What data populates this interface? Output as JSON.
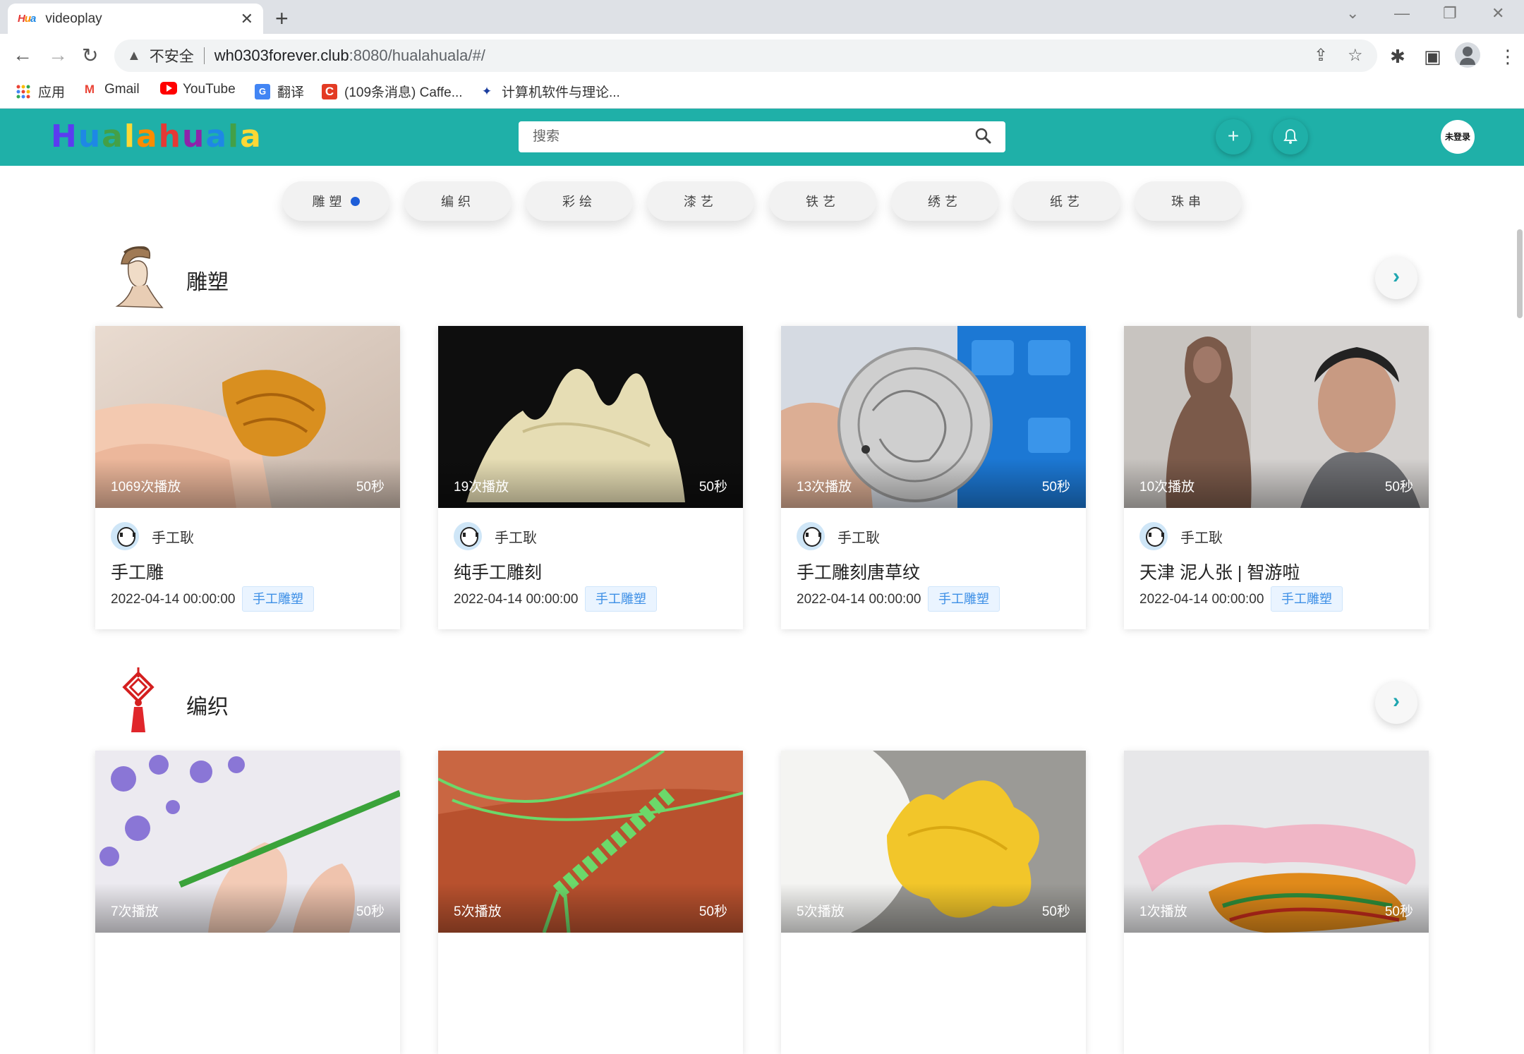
{
  "browser": {
    "tab_title": "videoplay",
    "favicon_text": "Hua",
    "insecure_label": "不安全",
    "url_host": "wh0303forever.club",
    "url_rest": ":8080/hualahuala/#/",
    "bookmarks": [
      {
        "label": "应用",
        "icon": "apps-grid-icon"
      },
      {
        "label": "Gmail",
        "icon": "gmail-icon"
      },
      {
        "label": "YouTube",
        "icon": "youtube-icon"
      },
      {
        "label": "翻译",
        "icon": "translate-icon"
      },
      {
        "label": "(109条消息) Caffe...",
        "icon": "csdn-icon"
      },
      {
        "label": "计算机软件与理论...",
        "icon": "site-icon"
      }
    ]
  },
  "header": {
    "logo_letters": [
      "H",
      "u",
      "a",
      "l",
      "a",
      "h",
      "u",
      "a",
      "l",
      "a"
    ],
    "search_placeholder": "搜索",
    "login_label": "未登录"
  },
  "categories": [
    {
      "label": "雕塑",
      "active": true
    },
    {
      "label": "编织",
      "active": false
    },
    {
      "label": "彩绘",
      "active": false
    },
    {
      "label": "漆艺",
      "active": false
    },
    {
      "label": "铁艺",
      "active": false
    },
    {
      "label": "绣艺",
      "active": false
    },
    {
      "label": "纸艺",
      "active": false
    },
    {
      "label": "珠串",
      "active": false
    }
  ],
  "sections": [
    {
      "title": "雕塑",
      "videos": [
        {
          "plays": "1069次播放",
          "duration": "50秒",
          "author": "手工耿",
          "title": "手工雕",
          "date": "2022-04-14 00:00:00",
          "tag": "手工雕塑"
        },
        {
          "plays": "19次播放",
          "duration": "50秒",
          "author": "手工耿",
          "title": "纯手工雕刻",
          "date": "2022-04-14 00:00:00",
          "tag": "手工雕塑"
        },
        {
          "plays": "13次播放",
          "duration": "50秒",
          "author": "手工耿",
          "title": "手工雕刻唐草纹",
          "date": "2022-04-14 00:00:00",
          "tag": "手工雕塑"
        },
        {
          "plays": "10次播放",
          "duration": "50秒",
          "author": "手工耿",
          "title": "天津 泥人张 | 智游啦",
          "date": "2022-04-14 00:00:00",
          "tag": "手工雕塑"
        }
      ]
    },
    {
      "title": "编织",
      "videos": [
        {
          "plays": "7次播放",
          "duration": "50秒"
        },
        {
          "plays": "5次播放",
          "duration": "50秒"
        },
        {
          "plays": "5次播放",
          "duration": "50秒"
        },
        {
          "plays": "1次播放",
          "duration": "50秒"
        }
      ]
    }
  ],
  "colors": {
    "header_bg": "#1fb0a8",
    "active_dot": "#1e5ed8",
    "tag_text": "#3d8fe6"
  }
}
